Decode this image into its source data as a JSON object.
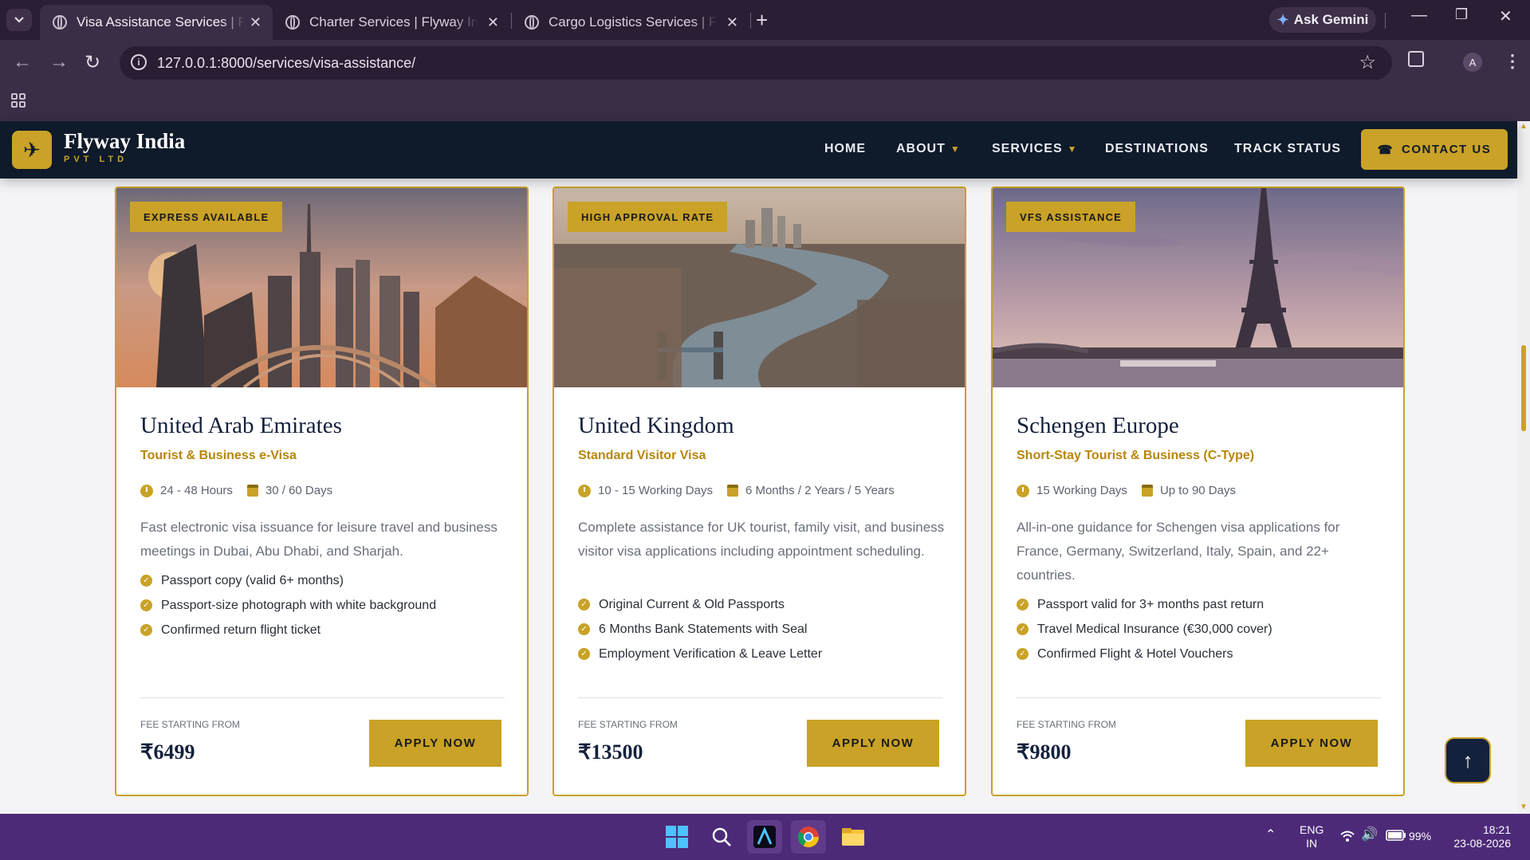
{
  "browser": {
    "tabs": [
      {
        "title": "Visa Assistance Services | Flyway India Pvt Ltd",
        "active": true
      },
      {
        "title": "Charter Services | Flyway India Pvt Ltd",
        "active": false
      },
      {
        "title": "Cargo Logistics Services | Flyway India Pvt Ltd",
        "active": false
      }
    ],
    "gemini_label": "Ask Gemini",
    "url": "127.0.0.1:8000/services/visa-assistance/",
    "profile_initial": "A"
  },
  "site": {
    "brand_name": "Flyway India",
    "brand_sub": "PVT LTD",
    "nav": {
      "home": "HOME",
      "about": "ABOUT",
      "services": "SERVICES",
      "destinations": "DESTINATIONS",
      "track": "TRACK STATUS",
      "contact": "CONTACT US"
    },
    "accent_color": "#c9a227",
    "navy_color": "#0f1a2a"
  },
  "cards": [
    {
      "badge": "EXPRESS AVAILABLE",
      "country": "United Arab Emirates",
      "visa_type": "Tourist & Business e-Visa",
      "processing": "24 - 48 Hours",
      "validity": "30 / 60 Days",
      "description": "Fast electronic visa issuance for leisure travel and business meetings in Dubai, Abu Dhabi, and Sharjah.",
      "requirements": [
        "Passport copy (valid 6+ months)",
        "Passport-size photograph with white background",
        "Confirmed return flight ticket"
      ],
      "fee_label": "FEE STARTING FROM",
      "fee": "₹6499",
      "apply_label": "APPLY NOW",
      "image_icon": "dubai-skyline-photo"
    },
    {
      "badge": "HIGH APPROVAL RATE",
      "country": "United Kingdom",
      "visa_type": "Standard Visitor Visa",
      "processing": "10 - 15 Working Days",
      "validity": "6 Months / 2 Years / 5 Years",
      "description": "Complete assistance for UK tourist, family visit, and business visitor visa applications including appointment scheduling.",
      "requirements": [
        "Original Current & Old Passports",
        "6 Months Bank Statements with Seal",
        "Employment Verification & Leave Letter"
      ],
      "fee_label": "FEE STARTING FROM",
      "fee": "₹13500",
      "apply_label": "APPLY NOW",
      "image_icon": "london-thames-photo"
    },
    {
      "badge": "VFS ASSISTANCE",
      "country": "Schengen Europe",
      "visa_type": "Short-Stay Tourist & Business (C-Type)",
      "processing": "15 Working Days",
      "validity": "Up to 90 Days",
      "description": "All-in-one guidance for Schengen visa applications for France, Germany, Switzerland, Italy, Spain, and 22+ countries.",
      "requirements": [
        "Passport valid for 3+ months past return",
        "Travel Medical Insurance (€30,000 cover)",
        "Confirmed Flight & Hotel Vouchers"
      ],
      "fee_label": "FEE STARTING FROM",
      "fee": "₹9800",
      "apply_label": "APPLY NOW",
      "image_icon": "eiffel-tower-photo"
    }
  ],
  "taskbar": {
    "lang_top": "ENG",
    "lang_bottom": "IN",
    "battery": "99%",
    "time": "18:21",
    "date": "23-08-2026"
  }
}
